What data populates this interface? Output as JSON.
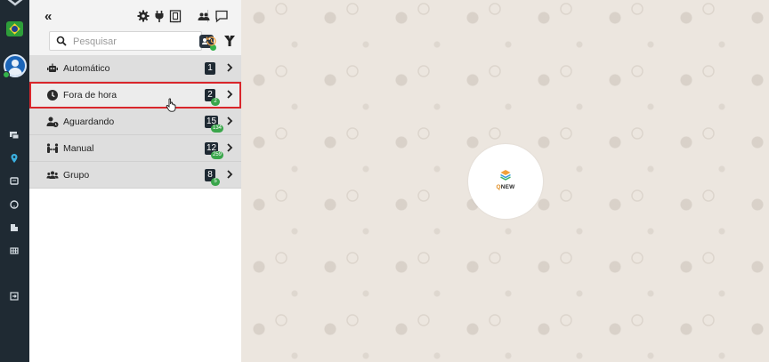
{
  "header": {
    "collapse_icon": "double-chevron-left",
    "toolbar_icons": [
      "gear-icon",
      "plug-icon",
      "clipboard-icon",
      "users-icon",
      "chat-icon"
    ],
    "search_placeholder": "Pesquisar",
    "filter_icon": "filter-icon",
    "history_icon": "history-icon",
    "tag_icon": "tag-icon"
  },
  "rail": {
    "icons": [
      "chevron-down-icon",
      "brazil-flag-icon",
      "avatar-icon",
      "chat-list-icon",
      "location-icon",
      "message-icon",
      "help-icon",
      "building-icon",
      "grid-icon",
      "logout-icon"
    ],
    "status": "online",
    "colors": {
      "background": "#1f2a33",
      "online": "#34b24a",
      "accent": "#1b65b8"
    }
  },
  "queues": [
    {
      "label": "Automático",
      "icon": "robot-icon",
      "count": "1",
      "sub": ""
    },
    {
      "label": "Fora de hora",
      "icon": "clock-icon",
      "count": "2",
      "sub": "2",
      "selected": true
    },
    {
      "label": "Aguardando",
      "icon": "user-clock-icon",
      "count": "15",
      "sub": "134"
    },
    {
      "label": "Manual",
      "icon": "people-arrows-icon",
      "count": "12",
      "sub": "259"
    },
    {
      "label": "Grupo",
      "icon": "users-group-icon",
      "count": "8",
      "sub": "5"
    }
  ],
  "brand": {
    "logo_prefix": "Q",
    "logo_rest": "NEW",
    "colors": {
      "badge": "#1f2a33",
      "sub_badge": "#3aa64b",
      "selection": "#d9262b",
      "logo_accent": "#e08a1e"
    }
  }
}
